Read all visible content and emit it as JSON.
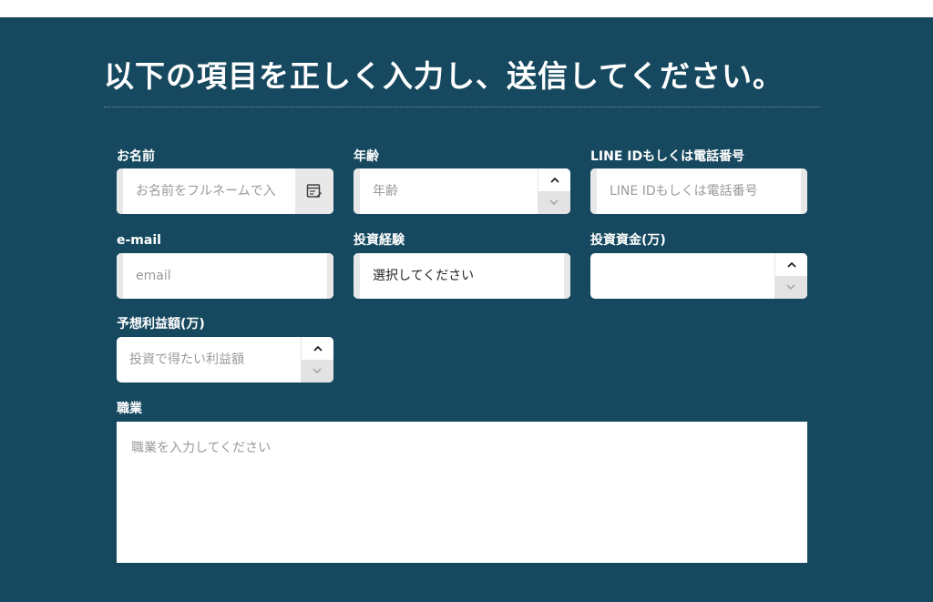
{
  "form": {
    "heading": "以下の項目を正しく入力し、送信してください。",
    "name": {
      "label": "お名前",
      "placeholder": "お名前をフルネームで入",
      "icon": "contact-card-icon"
    },
    "age": {
      "label": "年齢",
      "placeholder": "年齢"
    },
    "line_id": {
      "label": "LINE IDもしくは電話番号",
      "placeholder": "LINE IDもしくは電話番号"
    },
    "email": {
      "label": "e-mail",
      "placeholder": "email"
    },
    "experience": {
      "label": "投資経験",
      "selected": "選択してください"
    },
    "funds": {
      "label": "投資資金(万)",
      "placeholder": ""
    },
    "expected_profit": {
      "label": "予想利益額(万)",
      "placeholder": "投資で得たい利益額"
    },
    "occupation": {
      "label": "職業",
      "placeholder": "職業を入力してください"
    }
  },
  "colors": {
    "background": "#16495f",
    "field": "#ffffff",
    "text": "#ffffff"
  }
}
